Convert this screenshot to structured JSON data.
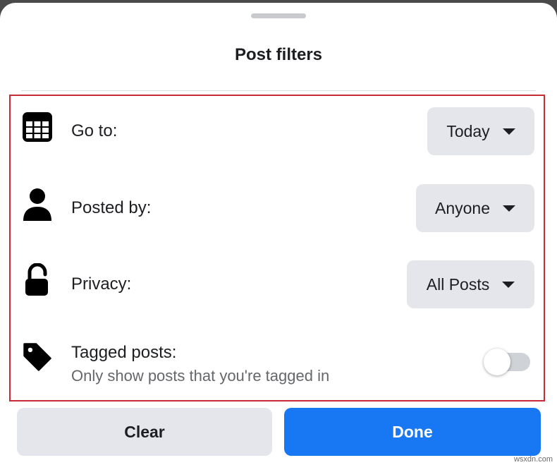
{
  "sheet": {
    "title": "Post filters"
  },
  "filters": [
    {
      "icon": "calendar-icon",
      "label": "Go to:",
      "value": "Today"
    },
    {
      "icon": "person-icon",
      "label": "Posted by:",
      "value": "Anyone"
    },
    {
      "icon": "unlock-icon",
      "label": "Privacy:",
      "value": "All Posts"
    }
  ],
  "tagged": {
    "icon": "tag-icon",
    "label": "Tagged posts:",
    "description": "Only show posts that you're tagged in",
    "enabled": false
  },
  "actions": {
    "clear_label": "Clear",
    "done_label": "Done"
  },
  "colors": {
    "accent": "#1877f2",
    "highlight_border": "#c62b36",
    "button_grey": "#e4e6eb"
  },
  "watermark": "wsxdn.com"
}
